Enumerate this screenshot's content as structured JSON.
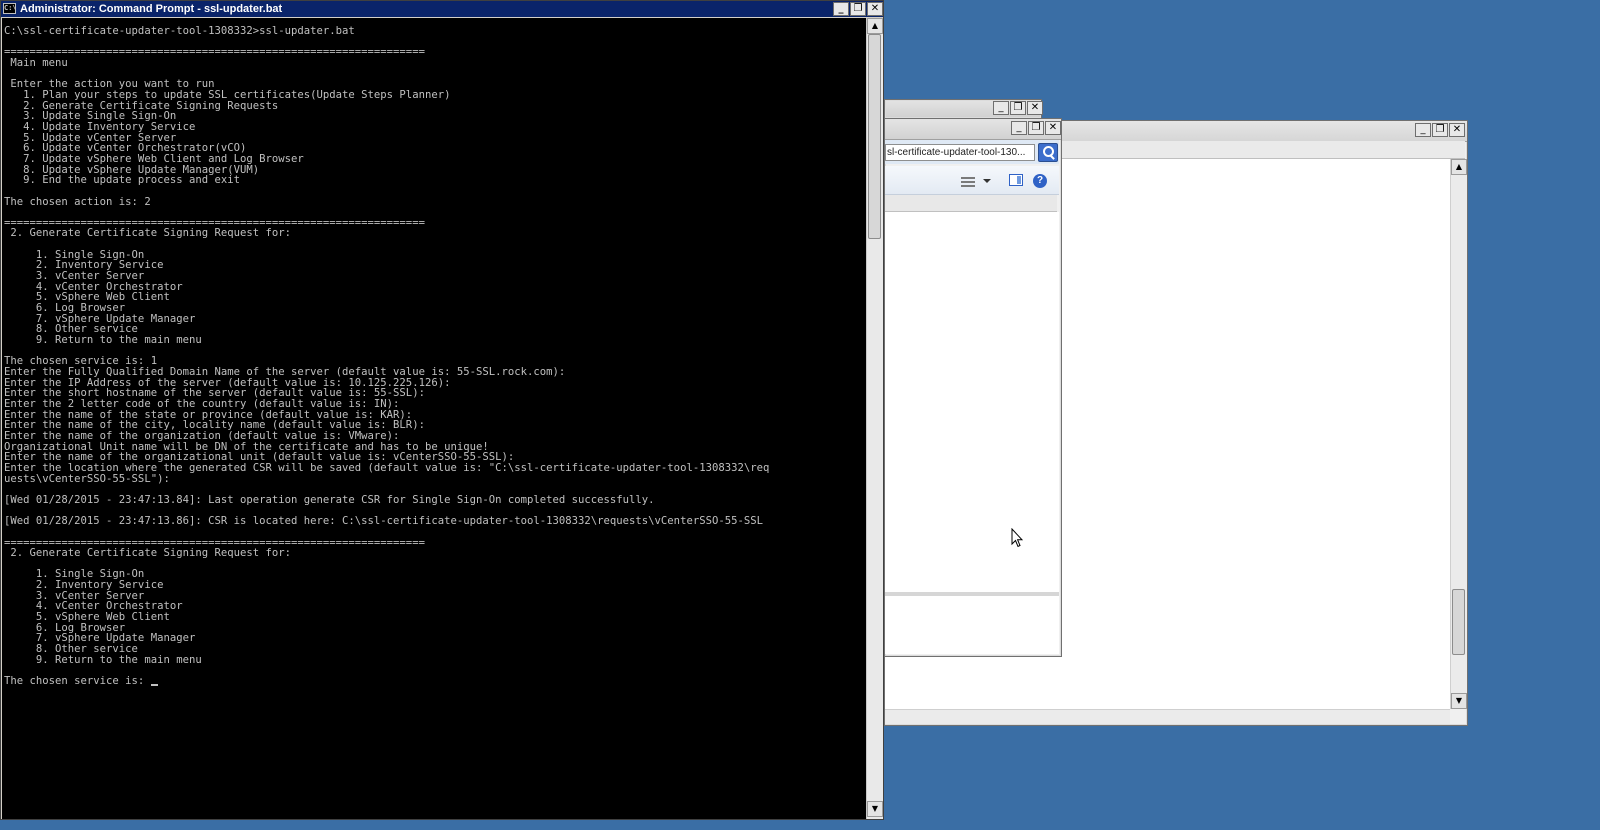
{
  "desktop": {
    "background_color": "#3a6ea5"
  },
  "cmd_window": {
    "title": "Administrator: Command Prompt - ssl-updater.bat",
    "title_icon": "C:\\",
    "console_lines": [
      "C:\\ssl-certificate-updater-tool-1308332>ssl-updater.bat",
      "",
      "==================================================================",
      " Main menu",
      "",
      " Enter the action you want to run",
      "   1. Plan your steps to update SSL certificates(Update Steps Planner)",
      "   2. Generate Certificate Signing Requests",
      "   3. Update Single Sign-On",
      "   4. Update Inventory Service",
      "   5. Update vCenter Server",
      "   6. Update vCenter Orchestrator(vCO)",
      "   7. Update vSphere Web Client and Log Browser",
      "   8. Update vSphere Update Manager(VUM)",
      "   9. End the update process and exit",
      "",
      "The chosen action is: 2",
      "",
      "==================================================================",
      " 2. Generate Certificate Signing Request for:",
      "",
      "     1. Single Sign-On",
      "     2. Inventory Service",
      "     3. vCenter Server",
      "     4. vCenter Orchestrator",
      "     5. vSphere Web Client",
      "     6. Log Browser",
      "     7. vSphere Update Manager",
      "     8. Other service",
      "     9. Return to the main menu",
      "",
      "The chosen service is: 1",
      "Enter the Fully Qualified Domain Name of the server (default value is: 55-SSL.rock.com):",
      "Enter the IP Address of the server (default value is: 10.125.225.126):",
      "Enter the short hostname of the server (default value is: 55-SSL):",
      "Enter the 2 letter code of the country (default value is: IN):",
      "Enter the name of the state or province (default value is: KAR):",
      "Enter the name of the city, locality name (default value is: BLR):",
      "Enter the name of the organization (default value is: VMware):",
      "Organizational Unit name will be DN of the certificate and has to be unique!",
      "Enter the name of the organizational unit (default value is: vCenterSSO-55-SSL):",
      "Enter the location where the generated CSR will be saved (default value is: \"C:\\ssl-certificate-updater-tool-1308332\\req",
      "uests\\vCenterSSO-55-SSL\"):",
      "",
      "[Wed 01/28/2015 - 23:47:13.84]: Last operation generate CSR for Single Sign-On completed successfully.",
      "",
      "[Wed 01/28/2015 - 23:47:13.86]: CSR is located here: C:\\ssl-certificate-updater-tool-1308332\\requests\\vCenterSSO-55-SSL",
      "",
      "==================================================================",
      " 2. Generate Certificate Signing Request for:",
      "",
      "     1. Single Sign-On",
      "     2. Inventory Service",
      "     3. vCenter Server",
      "     4. vCenter Orchestrator",
      "     5. vSphere Web Client",
      "     6. Log Browser",
      "     7. vSphere Update Manager",
      "     8. Other service",
      "     9. Return to the main menu",
      ""
    ],
    "prompt_line": "The chosen service is: ",
    "buttons": {
      "minimize": "_",
      "restore": "❐",
      "close": "✕"
    }
  },
  "explorer_window": {
    "address_text": "sl-certificate-updater-tool-130...",
    "buttons": {
      "minimize": "_",
      "restore": "❐",
      "close": "✕"
    },
    "help_glyph": "?"
  },
  "back_window_1": {
    "buttons": {
      "minimize": "_",
      "restore": "❐",
      "close": "✕"
    }
  },
  "back_window_2": {
    "buttons": {
      "minimize": "_",
      "restore": "❐",
      "close": "✕"
    },
    "scroll_up": "▲",
    "scroll_down": "▼"
  }
}
